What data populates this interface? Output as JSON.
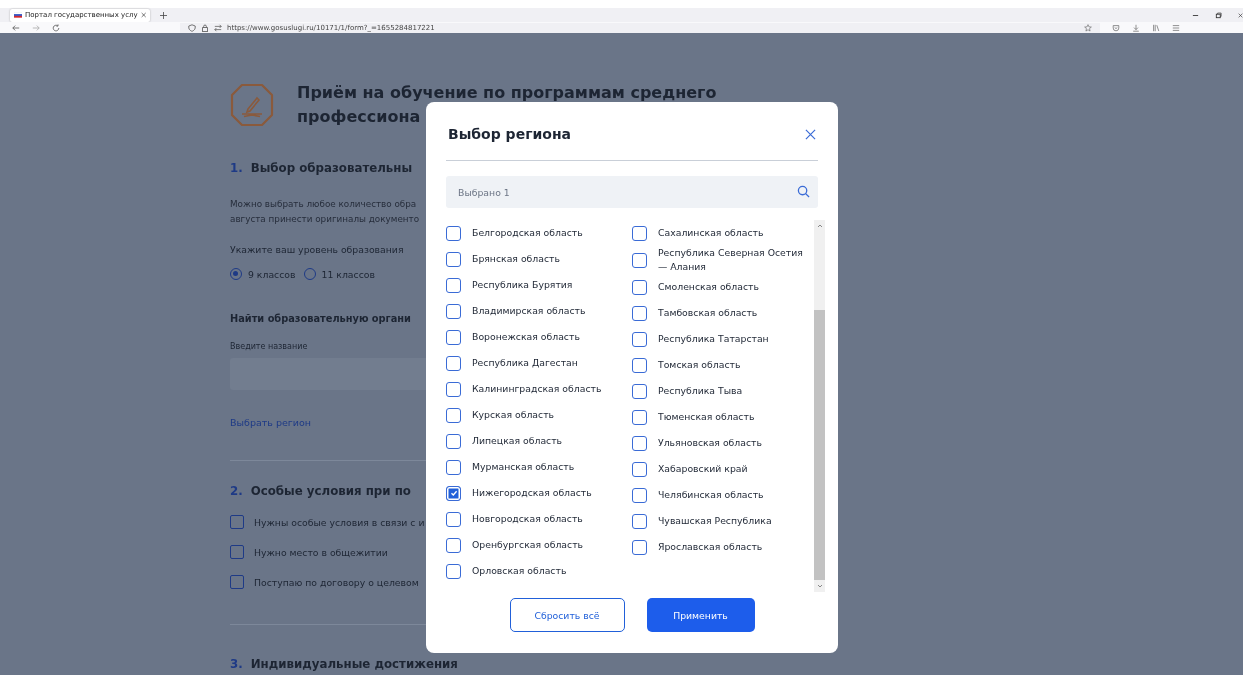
{
  "browser": {
    "tab": {
      "title": "Портал государственных услу",
      "selected": true
    },
    "url": "https://www.gosuslugi.ru/10171/1/form?_=1655284817221"
  },
  "page": {
    "title_lines": [
      "Приём на обучение по программам среднего",
      "профессиона"
    ],
    "sections": [
      {
        "number": "1.",
        "title": "Выбор образовательны"
      },
      {
        "number": "2.",
        "title": "Особые условия при по"
      },
      {
        "number": "3.",
        "title": "Индивидуальные достижения"
      }
    ],
    "intro_lines": [
      "Можно выбрать любое количество обра",
      "августа принести оригиналы документо"
    ],
    "level_label": "Укажите ваш уровень образования",
    "levels": [
      {
        "label": "9 классов",
        "selected": true
      },
      {
        "label": "11 классов",
        "selected": false
      }
    ],
    "find_title": "Найти образовательную органи",
    "name_label": "Введите название",
    "region_link": "Выбрать регион",
    "conditions": [
      {
        "label": "Нужны особые условия в связи с и",
        "checked": false
      },
      {
        "label": "Нужно место в общежитии",
        "checked": false
      },
      {
        "label": "Поступаю по договору о целевом",
        "checked": false
      }
    ]
  },
  "dialog": {
    "title": "Выбор региона",
    "search": {
      "placeholder": "Выбрано 1"
    },
    "columns": [
      [
        {
          "label": "Белгородская область",
          "checked": false
        },
        {
          "label": "Брянская область",
          "checked": false
        },
        {
          "label": "Республика Бурятия",
          "checked": false
        },
        {
          "label": "Владимирская область",
          "checked": false
        },
        {
          "label": "Воронежская область",
          "checked": false
        },
        {
          "label": "Республика Дагестан",
          "checked": false
        },
        {
          "label": "Калининградская область",
          "checked": false
        },
        {
          "label": "Курская область",
          "checked": false
        },
        {
          "label": "Липецкая область",
          "checked": false
        },
        {
          "label": "Мурманская область",
          "checked": false
        },
        {
          "label": "Нижегородская область",
          "checked": true
        },
        {
          "label": "Новгородская область",
          "checked": false
        },
        {
          "label": "Оренбургская область",
          "checked": false
        },
        {
          "label": "Орловская область",
          "checked": false
        }
      ],
      [
        {
          "label": "Сахалинская область",
          "checked": false
        },
        {
          "label": "Республика Северная Осетия — Алания",
          "checked": false
        },
        {
          "label": "Смоленская область",
          "checked": false
        },
        {
          "label": "Тамбовская область",
          "checked": false
        },
        {
          "label": "Республика Татарстан",
          "checked": false
        },
        {
          "label": "Томская область",
          "checked": false
        },
        {
          "label": "Республика Тыва",
          "checked": false
        },
        {
          "label": "Тюменская область",
          "checked": false
        },
        {
          "label": "Ульяновская область",
          "checked": false
        },
        {
          "label": "Хабаровский край",
          "checked": false
        },
        {
          "label": "Челябинская область",
          "checked": false
        },
        {
          "label": "Чувашская Республика",
          "checked": false
        },
        {
          "label": "Ярославская область",
          "checked": false
        }
      ]
    ],
    "buttons": [
      {
        "label": "Сбросить всё",
        "kind": "outline"
      },
      {
        "label": "Применить",
        "kind": "primary"
      }
    ]
  }
}
